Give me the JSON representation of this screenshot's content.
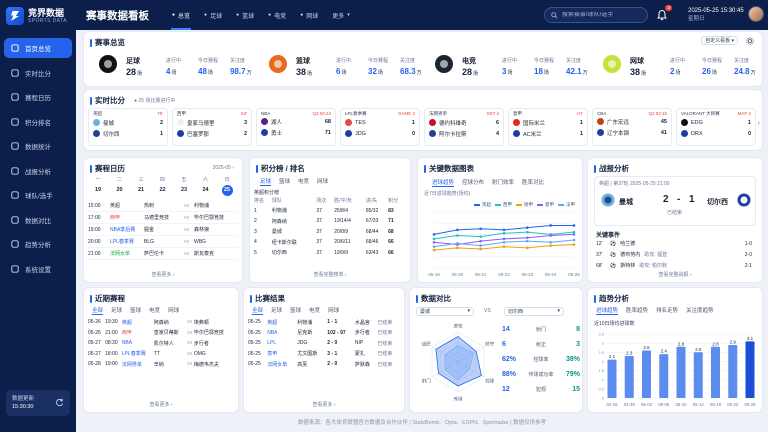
{
  "brand": {
    "name": "竞界数据",
    "sub": "SPORTS DATA"
  },
  "sidebar": {
    "items": [
      {
        "label": "首页总览",
        "icon": "home-icon",
        "active": true
      },
      {
        "label": "实时比分",
        "icon": "scoreboard-icon"
      },
      {
        "label": "赛程日历",
        "icon": "calendar-icon"
      },
      {
        "label": "积分排名",
        "icon": "trophy-icon"
      },
      {
        "label": "数据统计",
        "icon": "bar-chart-icon"
      },
      {
        "label": "战报分析",
        "icon": "document-icon"
      },
      {
        "label": "球队/选手",
        "icon": "users-icon"
      },
      {
        "label": "数据对比",
        "icon": "compare-icon"
      },
      {
        "label": "趋势分析",
        "icon": "trend-icon"
      },
      {
        "label": "系统设置",
        "icon": "gear-icon"
      }
    ],
    "sync": {
      "label": "数据更新",
      "time": "15:30:30"
    }
  },
  "header": {
    "title": "赛事数据看板",
    "tabs": [
      "总览",
      "足球",
      "篮球",
      "电竞",
      "网球",
      "更多"
    ],
    "search_placeholder": "搜索赛事/球队/选手",
    "notif_count": "3",
    "datetime": "2025-05-25 15:30:45",
    "weekday": "星期日"
  },
  "overview": {
    "title": "赛事总览",
    "custom_label": "自定义看板",
    "stat_labels": [
      "进行中",
      "今日赛程",
      "关注度"
    ],
    "sports": [
      {
        "name": "足球",
        "total": "28",
        "unit": "场",
        "live": "4",
        "today": "48",
        "attention": "98.7",
        "attention_unit": "万"
      },
      {
        "name": "篮球",
        "total": "38",
        "unit": "场",
        "live": "6",
        "today": "32",
        "attention": "68.3",
        "attention_unit": "万"
      },
      {
        "name": "电竞",
        "total": "28",
        "unit": "场",
        "live": "3",
        "today": "18",
        "attention": "42.1",
        "attention_unit": "万"
      },
      {
        "name": "网球",
        "total": "38",
        "unit": "场",
        "live": "2",
        "today": "26",
        "attention": "24.8",
        "attention_unit": "万"
      }
    ],
    "live_units": [
      "场",
      "场",
      "场"
    ]
  },
  "scores": {
    "title": "实时比分",
    "live_note": "25 场比赛进行中",
    "matches": [
      {
        "league": "英超",
        "status": "78'",
        "home": "曼城",
        "hs": "2",
        "away": "切尔西",
        "as": "1"
      },
      {
        "league": "西甲",
        "status": "63'",
        "home": "皇家马德里",
        "hs": "3",
        "away": "巴塞罗那",
        "as": "2"
      },
      {
        "league": "NBA",
        "status": "Q3 06:24",
        "home": "湖人",
        "hs": "68",
        "away": "勇士",
        "as": "71"
      },
      {
        "league": "LPL春季赛",
        "status": "GAME 2",
        "home": "TES",
        "hs": "1",
        "away": "JDG",
        "as": "0"
      },
      {
        "league": "法网男单",
        "status": "SET 2",
        "home": "德约科维奇",
        "hs": "6",
        "away": "阿尔卡拉斯",
        "as": "4"
      },
      {
        "league": "意甲",
        "status": "HT",
        "home": "国际米兰",
        "hs": "1",
        "away": "AC米兰",
        "as": "1"
      },
      {
        "league": "CBA",
        "status": "Q2 02:15",
        "home": "广东宏远",
        "hs": "45",
        "away": "辽宁本钢",
        "as": "41"
      },
      {
        "league": "VALORANT 大师赛",
        "status": "MAP 2",
        "home": "EDG",
        "hs": "1",
        "away": "DRX",
        "as": "0"
      }
    ]
  },
  "schedule": {
    "title": "赛程日历",
    "month": "2025-05",
    "weekdays": [
      "一",
      "二",
      "三",
      "四",
      "五",
      "六",
      "日"
    ],
    "dates": [
      "19",
      "20",
      "21",
      "22",
      "23",
      "24",
      "25"
    ],
    "rows": [
      {
        "time": "15:00",
        "league": "英超",
        "match": "热刺",
        "vs": "vs",
        "away": "利物浦"
      },
      {
        "time": "17:00",
        "league": "西甲",
        "match": "马德里竞技",
        "vs": "vs",
        "away": "毕尔巴鄂竞技"
      },
      {
        "time": "19:00",
        "league": "NBA季后赛",
        "match": "掘金",
        "vs": "vs",
        "away": "森林狼"
      },
      {
        "time": "20:00",
        "league": "LPL春季赛",
        "match": "BLG",
        "vs": "vs",
        "away": "WBG"
      },
      {
        "time": "21:00",
        "league": "法网女单",
        "match": "萨巴伦卡",
        "vs": "vs",
        "away": "斯瓦泰克"
      }
    ],
    "more": "查看更多"
  },
  "ranking": {
    "title": "积分榜 / 排名",
    "tabs": [
      "足球",
      "篮球",
      "电竞",
      "网球"
    ],
    "subtitle": "英超积分榜",
    "headers": [
      "排名",
      "球队",
      "场次",
      "胜/平/负",
      "进/失",
      "积分"
    ],
    "rows": [
      {
        "rank": "1",
        "team": "利物浦",
        "played": "37",
        "wdl": "25/8/4",
        "goals": "85/32",
        "pts": "83"
      },
      {
        "rank": "2",
        "team": "阿森纳",
        "played": "37",
        "wdl": "19/14/4",
        "goals": "67/33",
        "pts": "71"
      },
      {
        "rank": "3",
        "team": "曼城",
        "played": "37",
        "wdl": "20/8/9",
        "goals": "68/44",
        "pts": "68"
      },
      {
        "rank": "4",
        "team": "纽卡斯尔联",
        "played": "37",
        "wdl": "20/6/11",
        "goals": "68/46",
        "pts": "66"
      },
      {
        "rank": "5",
        "team": "切尔西",
        "played": "37",
        "wdl": "19/9/9",
        "goals": "63/43",
        "pts": "66"
      }
    ],
    "more": "查看完整榜单"
  },
  "keychart": {
    "title": "关键数据图表",
    "tabs": [
      "进球趋势",
      "控球分布",
      "射门效率",
      "胜率对比"
    ],
    "subtitle": "近7日进球趋势(场均)",
    "legend": [
      "英超",
      "西甲",
      "德甲",
      "意甲",
      "法甲"
    ],
    "colors": [
      "#2563eb",
      "#22c1c3",
      "#f59e0b",
      "#8b5cf6",
      "#60a5fa"
    ]
  },
  "chart_data": [
    {
      "type": "line",
      "title": "近7日进球趋势(场均)",
      "categories": [
        "05-19",
        "05-20",
        "05-21",
        "05-22",
        "05-23",
        "05-24",
        "05-25"
      ],
      "ylim": [
        0,
        5
      ],
      "series": [
        {
          "name": "英超",
          "values": [
            3.0,
            3.4,
            3.5,
            3.4,
            3.6,
            3.8,
            3.8
          ]
        },
        {
          "name": "西甲",
          "values": [
            2.6,
            2.9,
            2.8,
            3.1,
            3.2,
            3.0,
            3.2
          ]
        },
        {
          "name": "德甲",
          "values": [
            1.6,
            1.8,
            1.7,
            1.9,
            1.8,
            2.0,
            2.1
          ]
        },
        {
          "name": "意甲",
          "values": [
            2.3,
            2.1,
            2.4,
            2.6,
            2.7,
            2.9,
            3.0
          ]
        },
        {
          "name": "法甲",
          "values": [
            1.9,
            2.2,
            2.0,
            2.3,
            2.4,
            2.3,
            2.5
          ]
        }
      ]
    },
    {
      "type": "bar",
      "title": "近10日场均进球数",
      "categories": [
        "04-26",
        "04-28",
        "05-02",
        "05-06",
        "05-10",
        "05-14",
        "05-18",
        "05-22",
        "05-25"
      ],
      "values": [
        2.1,
        2.3,
        2.6,
        2.4,
        2.8,
        2.5,
        2.8,
        2.9,
        3.1
      ],
      "ylim": [
        0,
        3.5
      ]
    }
  ],
  "warreport": {
    "title": "战报分析",
    "league_line": "英超 | 第37轮  2025-05-25 21:00",
    "home": "曼城",
    "away": "切尔西",
    "score_h": "2",
    "score_a": "1",
    "status": "已结束",
    "events_title": "关键事件",
    "events": [
      {
        "min": "12'",
        "text": "哈兰德",
        "sub": "",
        "score": "1-0"
      },
      {
        "min": "37'",
        "text": "德布劳内",
        "sub": "助攻: 福登",
        "score": "2-0"
      },
      {
        "min": "68'",
        "text": "斯特林",
        "sub": "助攻: 帕尔默",
        "score": "2-1"
      }
    ],
    "more": "查看完整战报"
  },
  "recent": {
    "title": "近期赛程",
    "tabs": [
      "全部",
      "足球",
      "篮球",
      "电竞",
      "网球"
    ],
    "rows": [
      {
        "date": "05-26",
        "time": "19:30",
        "league": "英超",
        "home": "阿森纳",
        "vs": "vs",
        "away": "埃弗顿"
      },
      {
        "date": "05-26",
        "time": "21:00",
        "league": "西甲",
        "home": "皇家贝蒂斯",
        "vs": "vs",
        "away": "毕尔巴鄂竞技"
      },
      {
        "date": "05-27",
        "time": "08:30",
        "league": "NBA",
        "home": "凯尔特人",
        "vs": "vs",
        "away": "步行者"
      },
      {
        "date": "05-27",
        "time": "18:00",
        "league": "LPL春季赛",
        "home": "TT",
        "vs": "vs",
        "away": "OMG"
      },
      {
        "date": "05-28",
        "time": "19:00",
        "league": "法网男单",
        "home": "辛纳",
        "vs": "vs",
        "away": "梅德韦杰夫"
      }
    ],
    "more": "查看更多"
  },
  "results": {
    "title": "比赛结果",
    "tabs": [
      "全部",
      "足球",
      "篮球",
      "电竞",
      "网球"
    ],
    "rows": [
      {
        "date": "05-25",
        "league": "英超",
        "home": "利物浦",
        "score": "1 - 1",
        "away": "水晶宫",
        "status": "已结束"
      },
      {
        "date": "05-25",
        "league": "NBA",
        "home": "尼克斯",
        "score": "102 - 97",
        "away": "步行者",
        "status": "已结束"
      },
      {
        "date": "05-25",
        "league": "LPL",
        "home": "JDG",
        "score": "2 - 0",
        "away": "NIP",
        "status": "已结束"
      },
      {
        "date": "05-25",
        "league": "意甲",
        "home": "尤文图斯",
        "score": "3 - 1",
        "away": "蒙扎",
        "status": "已结束"
      },
      {
        "date": "05-25",
        "league": "法网女单",
        "home": "高芙",
        "score": "2 - 0",
        "away": "萨默森",
        "status": "已结束"
      }
    ],
    "more": "查看更多"
  },
  "compare": {
    "title": "数据对比",
    "team_a": "曼城",
    "team_b": "切尔西",
    "radar_labels": [
      "进攻",
      "防守",
      "控球",
      "传球",
      "射门",
      "组织"
    ],
    "stats": [
      {
        "a": "14",
        "label": "射门",
        "b": "8"
      },
      {
        "a": "6",
        "label": "射正",
        "b": "3"
      },
      {
        "a": "62%",
        "label": "控球率",
        "b": "38%"
      },
      {
        "a": "88%",
        "label": "传球成功率",
        "b": "79%"
      },
      {
        "a": "12",
        "label": "犯规",
        "b": "15"
      }
    ],
    "vs": "VS"
  },
  "trend": {
    "title": "趋势分析",
    "tabs": [
      "进球趋势",
      "胜率趋势",
      "排名走势",
      "关注度趋势"
    ],
    "subtitle": "近10日场均进球数"
  },
  "footer": "数据来源：各大体育联盟官方数据及合作伙伴 | StatsBomb、Opta、ESPN、Sportradar   |   数据仅供参考"
}
